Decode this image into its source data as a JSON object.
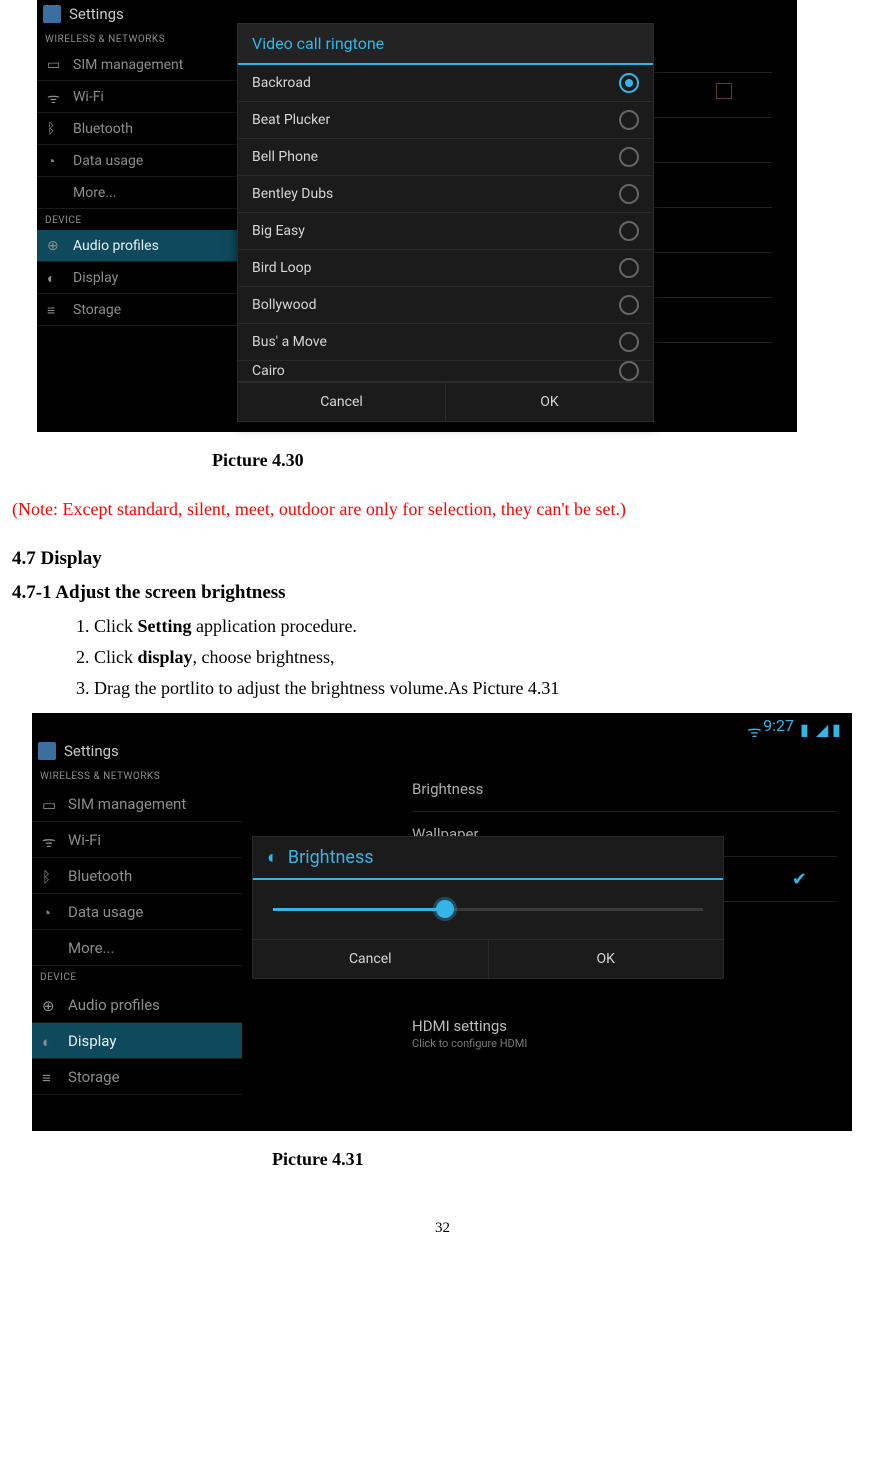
{
  "shot1": {
    "app_title": "Settings",
    "sections": {
      "wireless": "WIRELESS & NETWORKS",
      "device": "DEVICE"
    },
    "sidebar": [
      "SIM management",
      "Wi-Fi",
      "Bluetooth",
      "Data usage",
      "More...",
      "Audio profiles",
      "Display",
      "Storage"
    ],
    "sidebar_active": "Audio profiles",
    "dialog_title": "Video call ringtone",
    "options": [
      "Backroad",
      "Beat Plucker",
      "Bell Phone",
      "Bentley Dubs",
      "Big Easy",
      "Bird Loop",
      "Bollywood",
      "Bus' a Move",
      "Cairo"
    ],
    "selected": "Backroad",
    "cancel": "Cancel",
    "ok": "OK"
  },
  "caption1": "Picture 4.30",
  "note": "(Note: Except standard, silent, meet, outdoor are only for selection, they can't be set.)",
  "section": "4.7 Display",
  "subsection": "4.7-1 Adjust the screen brightness",
  "steps": {
    "s1a": "Click ",
    "s1b": "Setting",
    "s1c": " application procedure.",
    "s2a": "Click ",
    "s2b": "display",
    "s2c": ", choose brightness,",
    "s3": "Drag the portlito to adjust the brightness volume.As Picture 4.31"
  },
  "shot2": {
    "app_title": "Settings",
    "time": "9:27",
    "sections": {
      "wireless": "WIRELESS & NETWORKS",
      "device": "DEVICE"
    },
    "sidebar": [
      "SIM management",
      "Wi-Fi",
      "Bluetooth",
      "Data usage",
      "More...",
      "Audio profiles",
      "Display",
      "Storage"
    ],
    "sidebar_active": "Display",
    "main_items": {
      "brightness": "Brightness",
      "wallpaper": "Wallpaper",
      "hdmi": "HDMI settings",
      "hdmi_sub": "Click to configure HDMI"
    },
    "dialog_title": "Brightness",
    "cancel": "Cancel",
    "ok": "OK"
  },
  "caption2": "Picture 4.31",
  "pagenum": "32"
}
